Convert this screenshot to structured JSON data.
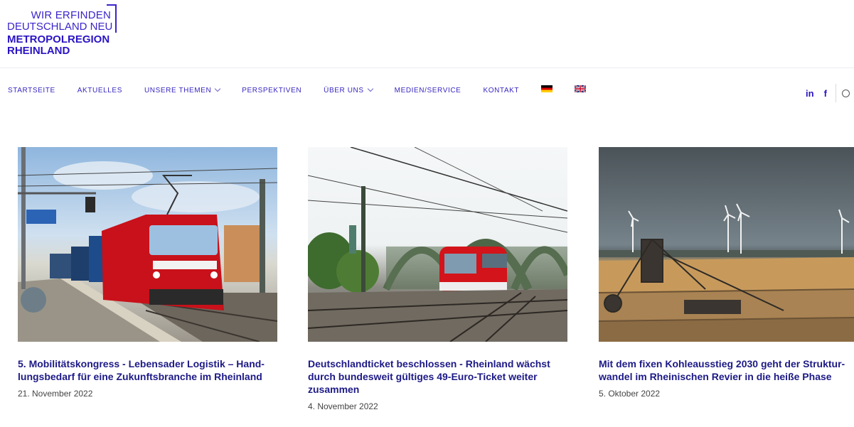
{
  "logo": {
    "line1": "WIR ERFINDEN",
    "line2": "DEUTSCHLAND NEU",
    "line3": "METROPOLREGION",
    "line4": "RHEINLAND"
  },
  "nav": {
    "items": [
      {
        "label": "STARTSEITE",
        "dropdown": false
      },
      {
        "label": "AKTUELLES",
        "dropdown": false
      },
      {
        "label": "UNSERE THEMEN",
        "dropdown": true
      },
      {
        "label": "PERSPEKTIVEN",
        "dropdown": false
      },
      {
        "label": "ÜBER UNS",
        "dropdown": true
      },
      {
        "label": "MEDIEN/SERVICE",
        "dropdown": false
      },
      {
        "label": "KONTAKT",
        "dropdown": false
      }
    ],
    "flags": [
      "flag-de-icon",
      "flag-uk-icon"
    ]
  },
  "social": {
    "linkedin": "in",
    "facebook": "f"
  },
  "colors": {
    "brand": "#2a14c4",
    "title": "#1d1a86",
    "date": "#444444"
  },
  "cards": [
    {
      "title": "5. Mobilitätskongress - Lebensader Logistik – Hand­lungsbedarf für eine Zukunftsbranche im Rheinland",
      "date": "21. November 2022",
      "image": "red-locomotive-train-station-image"
    },
    {
      "title": "Deutschlandticket beschlossen - Rheinland wächst durch bundesweit gültiges 49-Euro-Ticket weiter zusammen",
      "date": "4. November 2022",
      "image": "red-regional-train-bridge-image"
    },
    {
      "title": "Mit dem fixen Kohleausstieg 2030 geht der Struktur­wandel im Rheinischen Revier in die heiße Phase",
      "date": "5. Oktober 2022",
      "image": "open-pit-mine-wind-turbines-image"
    }
  ]
}
